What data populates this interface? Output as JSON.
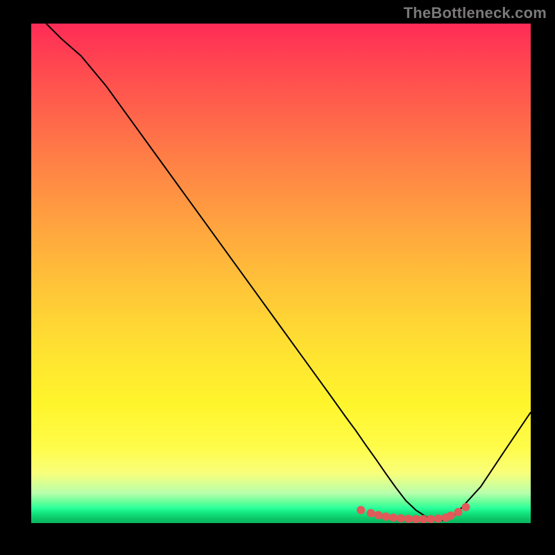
{
  "watermark": "TheBottleneck.com",
  "chart_data": {
    "type": "line",
    "title": "",
    "xlabel": "",
    "ylabel": "",
    "xlim": [
      0,
      100
    ],
    "ylim": [
      0,
      100
    ],
    "series": [
      {
        "name": "curve",
        "x": [
          3,
          6,
          10,
          15,
          20,
          25,
          30,
          35,
          40,
          45,
          50,
          55,
          60,
          63,
          65,
          67,
          69,
          71,
          73,
          75,
          77,
          79,
          81,
          83,
          85,
          90,
          95,
          100
        ],
        "y": [
          100,
          97,
          93.5,
          87.5,
          80.6,
          73.7,
          66.8,
          59.9,
          53,
          46.1,
          39.2,
          32.3,
          25.4,
          21.2,
          18.5,
          15.6,
          12.8,
          9.9,
          7.1,
          4.5,
          2.6,
          1.3,
          0.5,
          0.6,
          1.8,
          7.3,
          14.8,
          22.2
        ],
        "stroke": "#000000",
        "stroke_width": 2
      },
      {
        "name": "trough-markers",
        "type": "scatter",
        "x": [
          66,
          68,
          69.5,
          71,
          72.5,
          74,
          75.5,
          77,
          78.5,
          80,
          81.5,
          83,
          84,
          85.5,
          87
        ],
        "y": [
          2.6,
          2.0,
          1.6,
          1.3,
          1.1,
          0.95,
          0.85,
          0.8,
          0.78,
          0.8,
          0.9,
          1.1,
          1.5,
          2.2,
          3.2
        ],
        "marker_color": "#e05a5a",
        "marker_radius": 6
      }
    ],
    "background_gradient": {
      "direction": "vertical",
      "stops": [
        {
          "pos": 0.0,
          "color": "#ff2b56"
        },
        {
          "pos": 0.5,
          "color": "#ffc538"
        },
        {
          "pos": 0.8,
          "color": "#fff52c"
        },
        {
          "pos": 0.96,
          "color": "#5cff98"
        },
        {
          "pos": 1.0,
          "color": "#09b55e"
        }
      ]
    }
  }
}
